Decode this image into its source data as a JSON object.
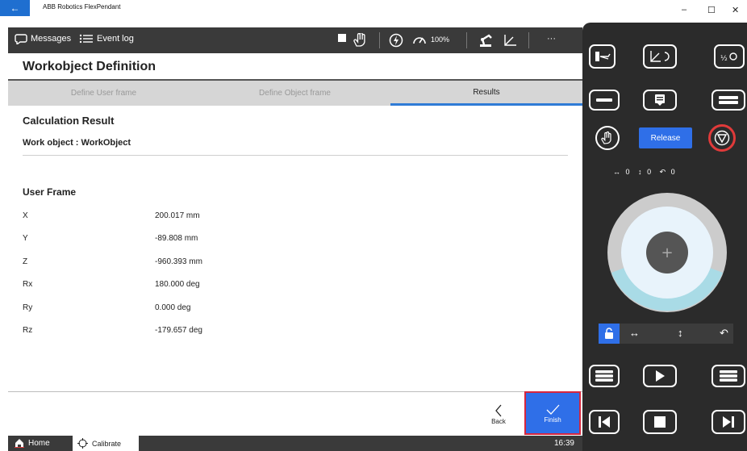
{
  "window": {
    "title": "ABB Robotics FlexPendant",
    "controls": {
      "minimize": "–",
      "maximize": "☐",
      "close": "✕"
    }
  },
  "appbar": {
    "messages_label": "Messages",
    "eventlog_label": "Event log",
    "speed_label": "100%",
    "more_label": "···"
  },
  "page": {
    "title": "Workobject Definition",
    "tabs": [
      {
        "label": "Define User frame",
        "active": false
      },
      {
        "label": "Define Object frame",
        "active": false
      },
      {
        "label": "Results",
        "active": true
      }
    ],
    "section_title": "Calculation Result",
    "work_object_label": "Work object :",
    "work_object_value": "WorkObject",
    "user_frame_title": "User Frame",
    "rows": [
      {
        "label": "X",
        "value": "200.017 mm"
      },
      {
        "label": "Y",
        "value": "-89.808 mm"
      },
      {
        "label": "Z",
        "value": "-960.393 mm"
      },
      {
        "label": "Rx",
        "value": "180.000 deg"
      },
      {
        "label": "Ry",
        "value": "0.000 deg"
      },
      {
        "label": "Rz",
        "value": "-179.657 deg"
      }
    ]
  },
  "footer": {
    "back_label": "Back",
    "finish_label": "Finish"
  },
  "statusbar": {
    "home_label": "Home",
    "calibrate_label": "Calibrate",
    "time": "16:39"
  },
  "panel": {
    "release_label": "Release",
    "axis_readout": [
      "↔",
      "0",
      "↕",
      "0",
      "↶",
      "0"
    ],
    "jog_center": "+"
  },
  "colors": {
    "accent_blue": "#2f6fe8",
    "tab_underline": "#2f7bd6",
    "highlight_red": "#d7263d",
    "dark_bar": "#3a3a3a",
    "panel_bg": "#2b2b2b",
    "jog_ring": "#a9dbe6"
  }
}
